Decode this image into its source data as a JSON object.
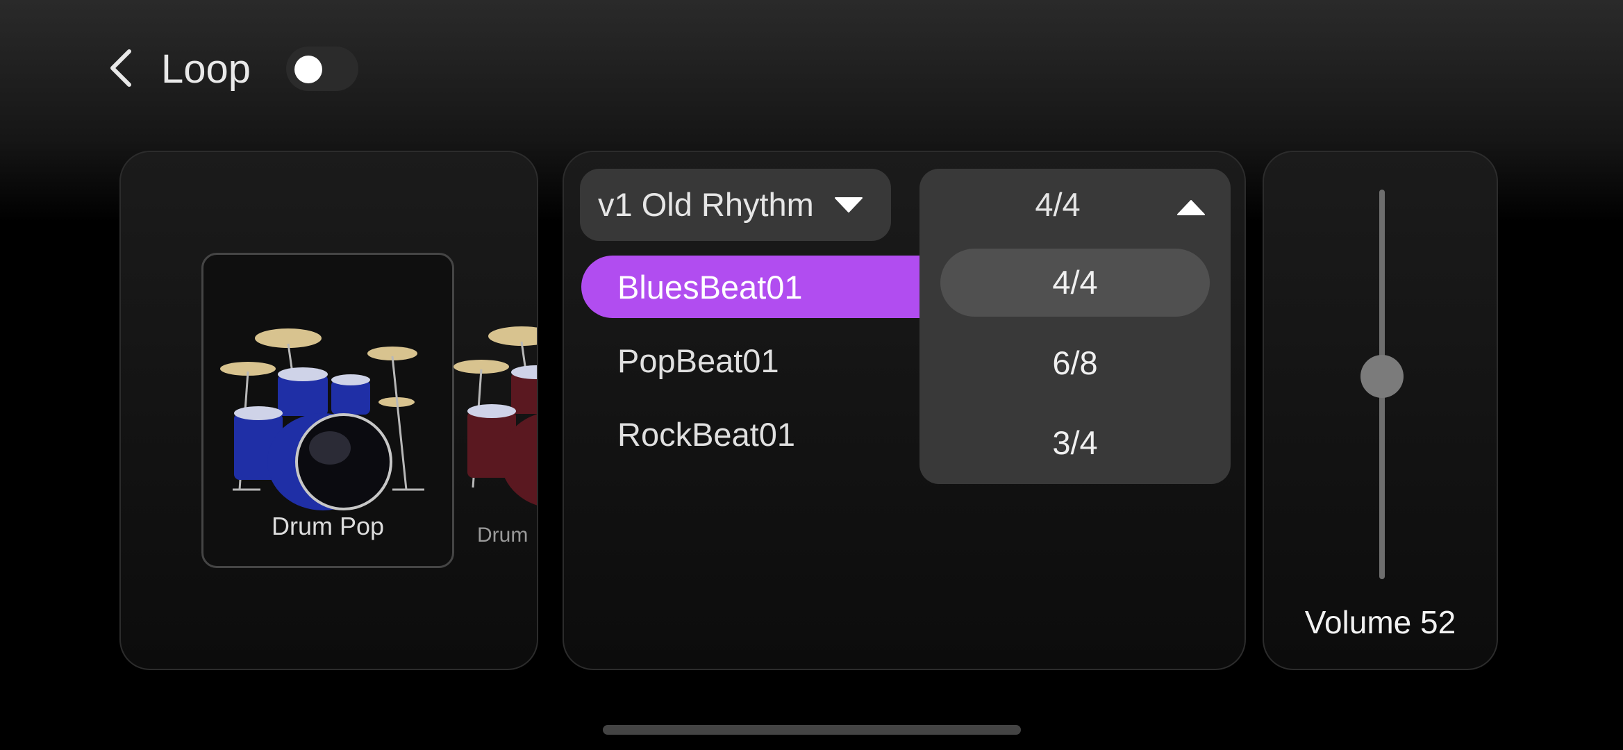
{
  "header": {
    "title": "Loop",
    "loop_enabled": false
  },
  "instruments": [
    {
      "name": "Drum Pop",
      "selected": true,
      "color": "#1f2fa6"
    },
    {
      "name": "Drum",
      "selected": false,
      "color": "#5a1820"
    }
  ],
  "rhythm": {
    "selected": "v1 Old Rhythm",
    "beats": [
      {
        "label": "BluesBeat01",
        "active": true
      },
      {
        "label": "PopBeat01",
        "active": false
      },
      {
        "label": "RockBeat01",
        "active": false
      }
    ]
  },
  "time_signature": {
    "selected": "4/4",
    "options": [
      "4/4",
      "6/8",
      "3/4"
    ]
  },
  "volume": {
    "label": "Volume",
    "value": "52",
    "level": 0.52
  },
  "colors": {
    "accent": "#b14df0"
  }
}
